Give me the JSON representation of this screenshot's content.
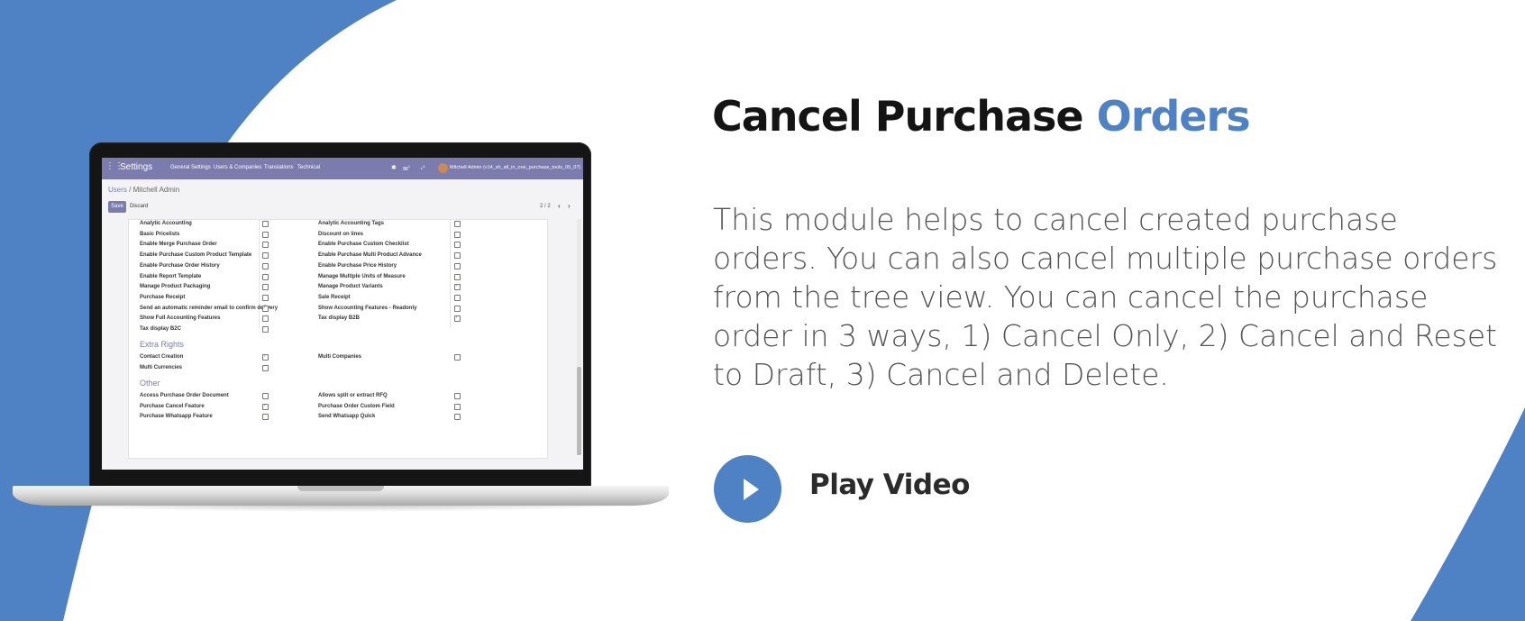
{
  "colors": {
    "accent": "#4e82c4",
    "odoo_purple": "#7c7bad",
    "title": "#141414",
    "text": "#555555"
  },
  "hero": {
    "title_main": "Cancel Purchase",
    "title_accent": "Orders",
    "description": "This module helps to cancel created purchase orders. You can also cancel multiple purchase orders from the tree view. You can cancel the purchase order in 3 ways, 1) Cancel Only, 2) Cancel and Reset to Draft, 3) Cancel and Delete.",
    "play_label": "Play Video",
    "play_icon": "play-icon"
  },
  "app": {
    "topbar": {
      "apps_icon": "grid-icon",
      "title": "Settings",
      "menu": [
        "General Settings",
        "Users & Companies",
        "Translations",
        "Technical"
      ],
      "icons": [
        "bug-icon",
        "chat-icon",
        "activity-icon"
      ],
      "chat_badge": "1",
      "activity_badge": "4",
      "user": "Mitchell Admin (v14_sh_all_in_one_purchase_tools_05_07)"
    },
    "breadcrumb": {
      "parent": "Users",
      "separator": " / ",
      "current": "Mitchell Admin"
    },
    "buttons": {
      "save": "Save",
      "discard": "Discard"
    },
    "pager": {
      "text": "2 / 2",
      "prev_icon": "chevron-left-icon",
      "next_icon": "chevron-right-icon"
    },
    "rows": [
      {
        "left": "Analytic Accounting",
        "left_checked": false,
        "right": "Analytic Accounting Tags",
        "right_checked": false
      },
      {
        "left": "Basic Pricelists",
        "left_checked": false,
        "right": "Discount on lines",
        "right_checked": false
      },
      {
        "left": "Enable Merge Purchase Order",
        "left_checked": false,
        "right": "Enable Purchase Custom Checklist",
        "right_checked": false
      },
      {
        "left": "Enable Purchase Custom Product Template",
        "left_checked": false,
        "right": "Enable Purchase Multi Product Advance",
        "right_checked": false
      },
      {
        "left": "Enable Purchase Order History",
        "left_checked": false,
        "right": "Enable Purchase Price History",
        "right_checked": false
      },
      {
        "left": "Enable Report Template",
        "left_checked": false,
        "right": "Manage Multiple Units of Measure",
        "right_checked": false
      },
      {
        "left": "Manage Product Packaging",
        "left_checked": false,
        "right": "Manage Product Variants",
        "right_checked": true
      },
      {
        "left": "Purchase Receipt",
        "left_checked": false,
        "right": "Sale Receipt",
        "right_checked": false
      },
      {
        "left": "Send an automatic reminder email to confirm delivery",
        "left_checked": true,
        "right": "Show Accounting Features - Readonly",
        "right_checked": false
      },
      {
        "left": "Show Full Accounting Features",
        "left_checked": false,
        "right": "Tax display B2B",
        "right_checked": true
      },
      {
        "left": "Tax display B2C",
        "left_checked": false,
        "right": "",
        "right_checked": false
      }
    ],
    "extra_rights": {
      "title": "Extra Rights",
      "rows": [
        {
          "left": "Contact Creation",
          "left_checked": true,
          "right": "Multi Companies",
          "right_checked": false
        },
        {
          "left": "Multi Currencies",
          "left_checked": false,
          "right": "",
          "right_checked": false
        }
      ]
    },
    "other": {
      "title": "Other",
      "rows": [
        {
          "left": "Access Purchase Order Document",
          "left_checked": false,
          "right": "Allows split or extract RFQ",
          "right_checked": false
        },
        {
          "left": "Purchase Cancel Feature",
          "left_checked": true,
          "right": "Purchase Order Custom Field",
          "right_checked": false
        },
        {
          "left": "Purchase Whatsapp Feature",
          "left_checked": false,
          "right": "Send Whatsapp Quick",
          "right_checked": false
        }
      ]
    }
  }
}
